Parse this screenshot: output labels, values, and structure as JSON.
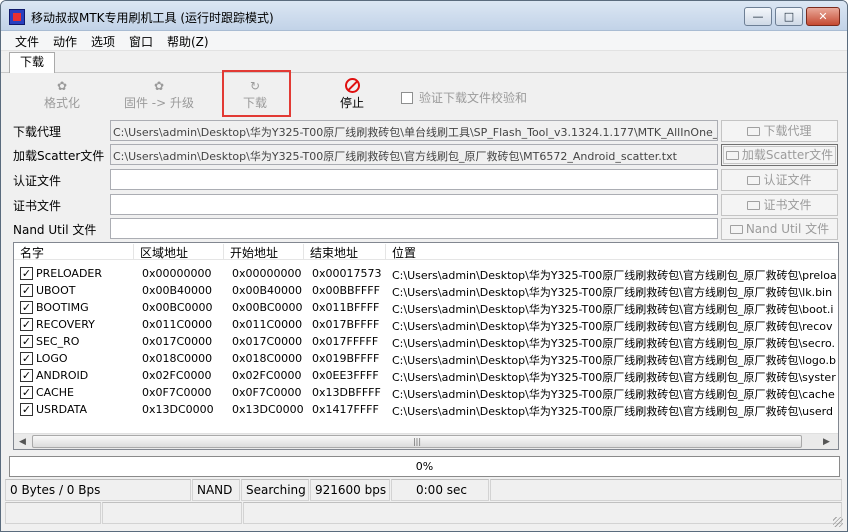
{
  "window": {
    "title": "移动叔叔MTK专用刷机工具 (运行时跟踪模式)"
  },
  "menu": [
    {
      "label": "文件"
    },
    {
      "label": "动作"
    },
    {
      "label": "选项"
    },
    {
      "label": "窗口"
    },
    {
      "label": "帮助(Z)"
    }
  ],
  "tab": {
    "label": "下载"
  },
  "toolbar": {
    "format_label": "格式化",
    "firmware_label": "固件 -> 升级",
    "download_label": "下载",
    "stop_label": "停止",
    "verify_label": "验证下载文件校验和"
  },
  "files": {
    "agent_label": "下载代理",
    "agent_path": "C:\\Users\\admin\\Desktop\\华为Y325-T00原厂线刷救砖包\\单台线刷工具\\SP_Flash_Tool_v3.1324.1.177\\MTK_AllInOne_DA",
    "agent_button": "下载代理",
    "scatter_label": "加载Scatter文件",
    "scatter_path": "C:\\Users\\admin\\Desktop\\华为Y325-T00原厂线刷救砖包\\官方线刷包_原厂救砖包\\MT6572_Android_scatter.txt",
    "scatter_button": "加载Scatter文件",
    "auth_label": "认证文件",
    "auth_path": "",
    "auth_button": "认证文件",
    "cert_label": "证书文件",
    "cert_path": "",
    "cert_button": "证书文件",
    "nand_label": "Nand Util 文件",
    "nand_path": "",
    "nand_button": "Nand Util 文件"
  },
  "table": {
    "columns": [
      "名字",
      "区域地址",
      "开始地址",
      "结束地址",
      "位置"
    ],
    "rows": [
      {
        "name": "PRELOADER",
        "region": "0x00000000",
        "start": "0x00000000",
        "end": "0x00017573",
        "location": "C:\\Users\\admin\\Desktop\\华为Y325-T00原厂线刷救砖包\\官方线刷包_原厂救砖包\\preloa"
      },
      {
        "name": "UBOOT",
        "region": "0x00B40000",
        "start": "0x00B40000",
        "end": "0x00BBFFFF",
        "location": "C:\\Users\\admin\\Desktop\\华为Y325-T00原厂线刷救砖包\\官方线刷包_原厂救砖包\\lk.bin"
      },
      {
        "name": "BOOTIMG",
        "region": "0x00BC0000",
        "start": "0x00BC0000",
        "end": "0x011BFFFF",
        "location": "C:\\Users\\admin\\Desktop\\华为Y325-T00原厂线刷救砖包\\官方线刷包_原厂救砖包\\boot.i"
      },
      {
        "name": "RECOVERY",
        "region": "0x011C0000",
        "start": "0x011C0000",
        "end": "0x017BFFFF",
        "location": "C:\\Users\\admin\\Desktop\\华为Y325-T00原厂线刷救砖包\\官方线刷包_原厂救砖包\\recov"
      },
      {
        "name": "SEC_RO",
        "region": "0x017C0000",
        "start": "0x017C0000",
        "end": "0x017FFFFF",
        "location": "C:\\Users\\admin\\Desktop\\华为Y325-T00原厂线刷救砖包\\官方线刷包_原厂救砖包\\secro."
      },
      {
        "name": "LOGO",
        "region": "0x018C0000",
        "start": "0x018C0000",
        "end": "0x019BFFFF",
        "location": "C:\\Users\\admin\\Desktop\\华为Y325-T00原厂线刷救砖包\\官方线刷包_原厂救砖包\\logo.b"
      },
      {
        "name": "ANDROID",
        "region": "0x02FC0000",
        "start": "0x02FC0000",
        "end": "0x0EE3FFFF",
        "location": "C:\\Users\\admin\\Desktop\\华为Y325-T00原厂线刷救砖包\\官方线刷包_原厂救砖包\\syster"
      },
      {
        "name": "CACHE",
        "region": "0x0F7C0000",
        "start": "0x0F7C0000",
        "end": "0x13DBFFFF",
        "location": "C:\\Users\\admin\\Desktop\\华为Y325-T00原厂线刷救砖包\\官方线刷包_原厂救砖包\\cache"
      },
      {
        "name": "USRDATA",
        "region": "0x13DC0000",
        "start": "0x13DC0000",
        "end": "0x1417FFFF",
        "location": "C:\\Users\\admin\\Desktop\\华为Y325-T00原厂线刷救砖包\\官方线刷包_原厂救砖包\\userd"
      }
    ]
  },
  "progress": {
    "text": "0%",
    "value": 0
  },
  "status": {
    "bytes": "0 Bytes / 0 Bps",
    "storage": "NAND",
    "state": "Searching",
    "baud": "921600 bps",
    "time": "0:00 sec"
  },
  "colors": {
    "highlight": "#e23a34",
    "stop": "#e01010",
    "title_gradient_top": "#dbe6f3"
  }
}
